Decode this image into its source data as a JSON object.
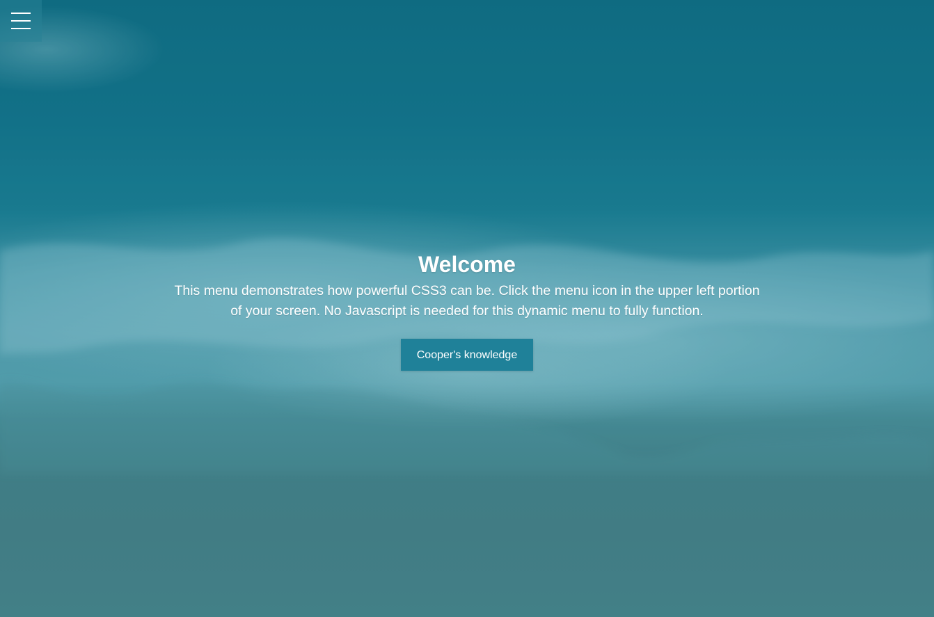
{
  "header": {
    "menu_icon": "hamburger-menu-icon"
  },
  "hero": {
    "title": "Welcome",
    "description": "This menu demonstrates how powerful CSS3 can be. Click the menu icon in the upper left portion of your screen. No Javascript is needed for this dynamic menu to fully function.",
    "button_label": "Cooper's knowledge"
  },
  "colors": {
    "button_background": "#1f8199",
    "text": "#ffffff",
    "ocean_deep": "#0e6b82",
    "sand": "#4b7f86"
  }
}
